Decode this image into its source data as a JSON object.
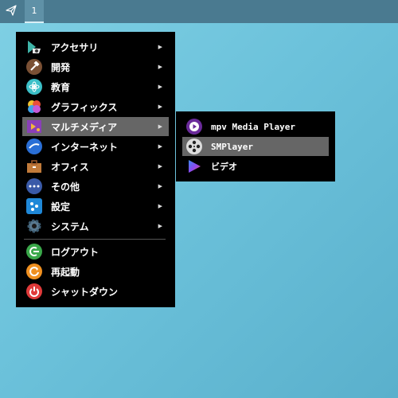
{
  "taskbar": {
    "start_icon": "paper-plane-icon",
    "desktop_label": "1"
  },
  "main_menu": {
    "items": [
      {
        "label": "アクセサリ",
        "icon": "accessories-icon",
        "submenu": true
      },
      {
        "label": "開発",
        "icon": "hammer-icon",
        "submenu": true
      },
      {
        "label": "教育",
        "icon": "education-icon",
        "submenu": true
      },
      {
        "label": "グラフィックス",
        "icon": "graphics-icon",
        "submenu": true
      },
      {
        "label": "マルチメディア",
        "icon": "multimedia-icon",
        "submenu": true,
        "highlighted": true
      },
      {
        "label": "インターネット",
        "icon": "internet-icon",
        "submenu": true
      },
      {
        "label": "オフィス",
        "icon": "briefcase-icon",
        "submenu": true
      },
      {
        "label": "その他",
        "icon": "more-icon",
        "submenu": true
      },
      {
        "label": "設定",
        "icon": "settings-icon",
        "submenu": true
      },
      {
        "label": "システム",
        "icon": "system-gear-icon",
        "submenu": true
      }
    ],
    "actions": [
      {
        "label": "ログアウト",
        "icon": "logout-icon"
      },
      {
        "label": "再起動",
        "icon": "restart-icon"
      },
      {
        "label": "シャットダウン",
        "icon": "power-icon"
      }
    ],
    "arrow": "▶"
  },
  "sub_menu": {
    "items": [
      {
        "label": "mpv Media Player",
        "icon": "mpv-icon"
      },
      {
        "label": "SMPlayer",
        "icon": "smplayer-film-reel-icon",
        "highlighted": true
      },
      {
        "label": "ビデオ",
        "icon": "video-play-icon"
      }
    ]
  },
  "colors": {
    "menu_bg": "#000000",
    "highlight": "#666666",
    "taskbar": "#4a7a90"
  }
}
